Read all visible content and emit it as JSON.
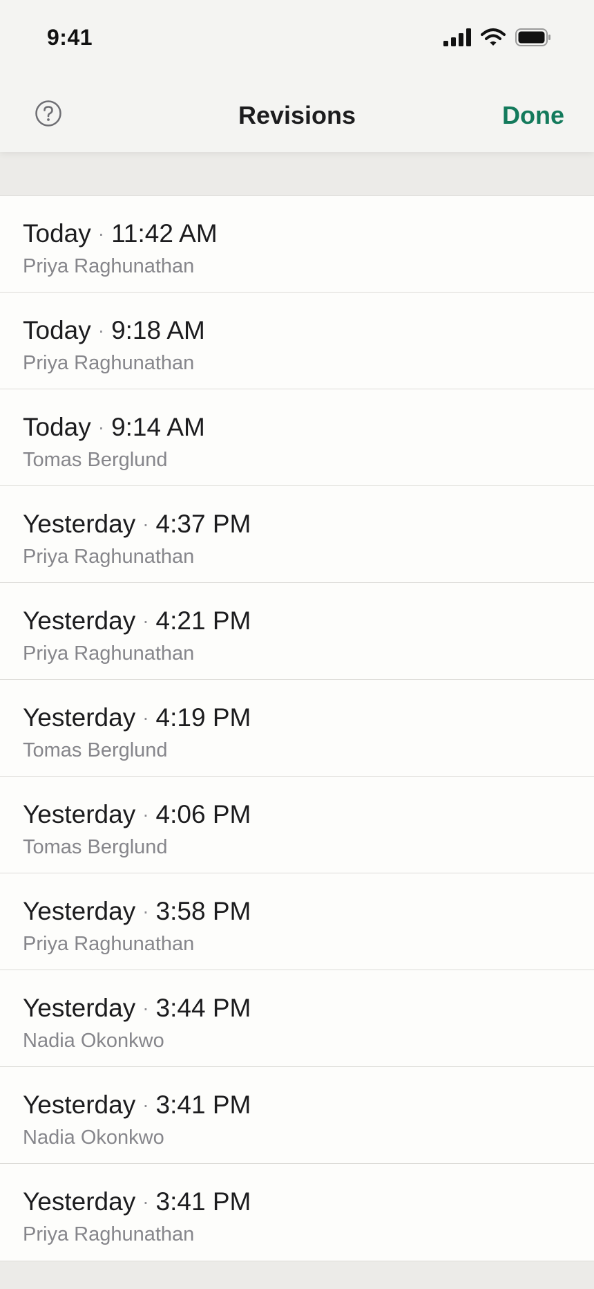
{
  "status_bar": {
    "time": "9:41",
    "signal_icon": "cellular-signal-icon",
    "wifi_icon": "wifi-icon",
    "battery_icon": "battery-icon"
  },
  "nav": {
    "help_icon": "help-circle-icon",
    "title": "Revisions",
    "done_label": "Done"
  },
  "colors": {
    "accent": "#137A5C",
    "primary_text": "#1C1C1E",
    "secondary_text": "#86868B",
    "list_background": "#FDFDFB",
    "page_background": "#ECEBE8"
  },
  "separator": "·",
  "revisions": [
    {
      "day": "Today",
      "time": "11:42 AM",
      "author": "Priya Raghunathan"
    },
    {
      "day": "Today",
      "time": "9:18 AM",
      "author": "Priya Raghunathan"
    },
    {
      "day": "Today",
      "time": "9:14 AM",
      "author": "Tomas Berglund"
    },
    {
      "day": "Yesterday",
      "time": "4:37 PM",
      "author": "Priya Raghunathan"
    },
    {
      "day": "Yesterday",
      "time": "4:21 PM",
      "author": "Priya Raghunathan"
    },
    {
      "day": "Yesterday",
      "time": "4:19 PM",
      "author": "Tomas Berglund"
    },
    {
      "day": "Yesterday",
      "time": "4:06 PM",
      "author": "Tomas Berglund"
    },
    {
      "day": "Yesterday",
      "time": "3:58 PM",
      "author": "Priya Raghunathan"
    },
    {
      "day": "Yesterday",
      "time": "3:44 PM",
      "author": "Nadia Okonkwo"
    },
    {
      "day": "Yesterday",
      "time": "3:41 PM",
      "author": "Nadia Okonkwo"
    },
    {
      "day": "Yesterday",
      "time": "3:41 PM",
      "author": "Priya Raghunathan"
    }
  ]
}
